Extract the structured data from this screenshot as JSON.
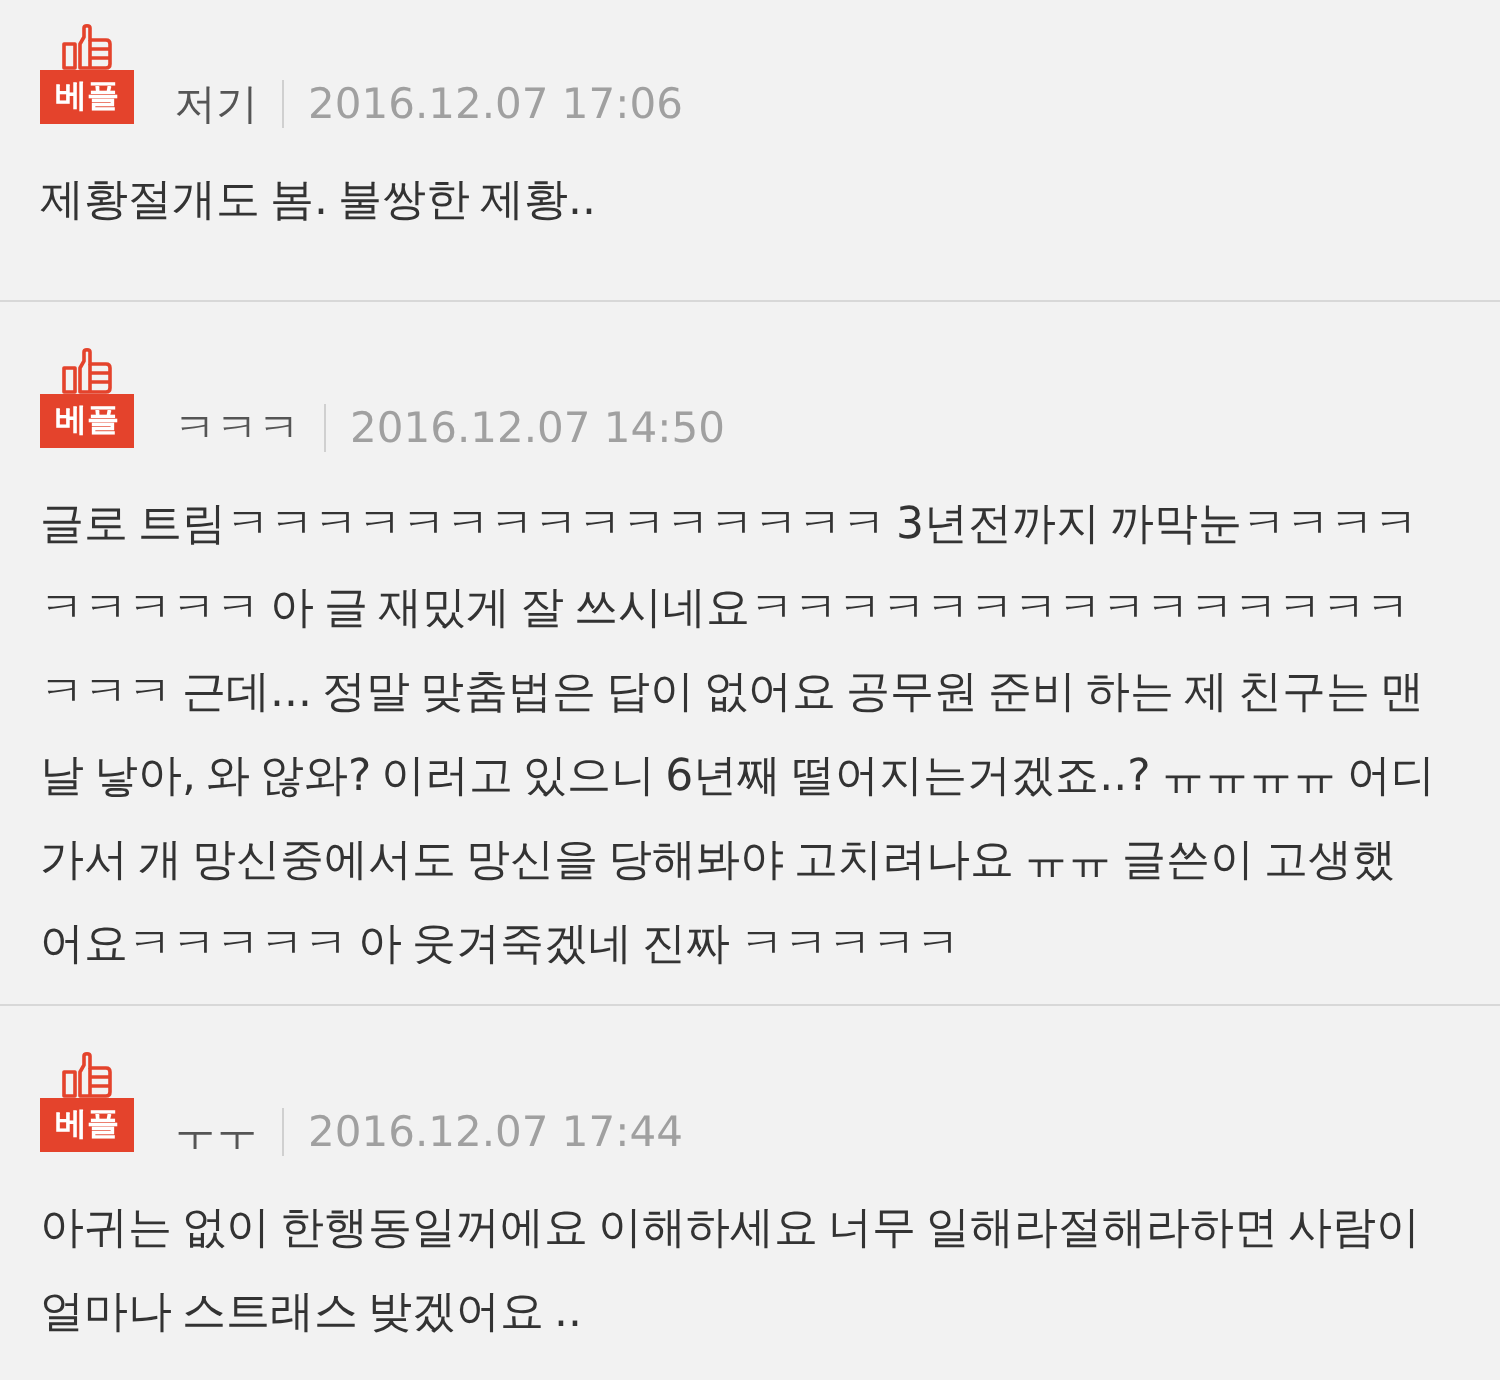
{
  "comments": [
    {
      "badge": "베플",
      "author": "저기",
      "date": "2016.12.07 17:06",
      "body": [
        "제황절개도 봄. 불쌍한 제황.."
      ]
    },
    {
      "badge": "베플",
      "author": "ㅋㅋㅋ",
      "date": "2016.12.07 14:50",
      "body": [
        "글로 트림ㅋㅋㅋㅋㅋㅋㅋㅋㅋㅋㅋㅋㅋㅋㅋ 3년전까지 까막눈ㅋㅋㅋㅋ",
        "ㅋㅋㅋㅋㅋ 아 글 재밌게 잘 쓰시네요ㅋㅋㅋㅋㅋㅋㅋㅋㅋㅋㅋㅋㅋㅋㅋ",
        "ㅋㅋㅋ 근데... 정말 맞춤법은 답이 없어요 공무원 준비 하는 제 친구는 맨",
        "날 낳아, 와 않와? 이러고 있으니 6년째 떨어지는거겠죠..? ㅠㅠㅠㅠ 어디",
        "가서 개 망신중에서도 망신을 당해봐야 고치려나요 ㅠㅠ 글쓴이 고생했",
        "어요ㅋㅋㅋㅋㅋ 아 웃겨죽겠네 진짜 ㅋㅋㅋㅋㅋ"
      ]
    },
    {
      "badge": "베플",
      "author": "ㅜㅜ",
      "date": "2016.12.07 17:44",
      "body": [
        "아귀는 없이 한행동일꺼에요 이해하세요 너무 일해라절해라하면 사람이",
        "얼마나 스트래스 밪겠어요 .."
      ]
    }
  ]
}
